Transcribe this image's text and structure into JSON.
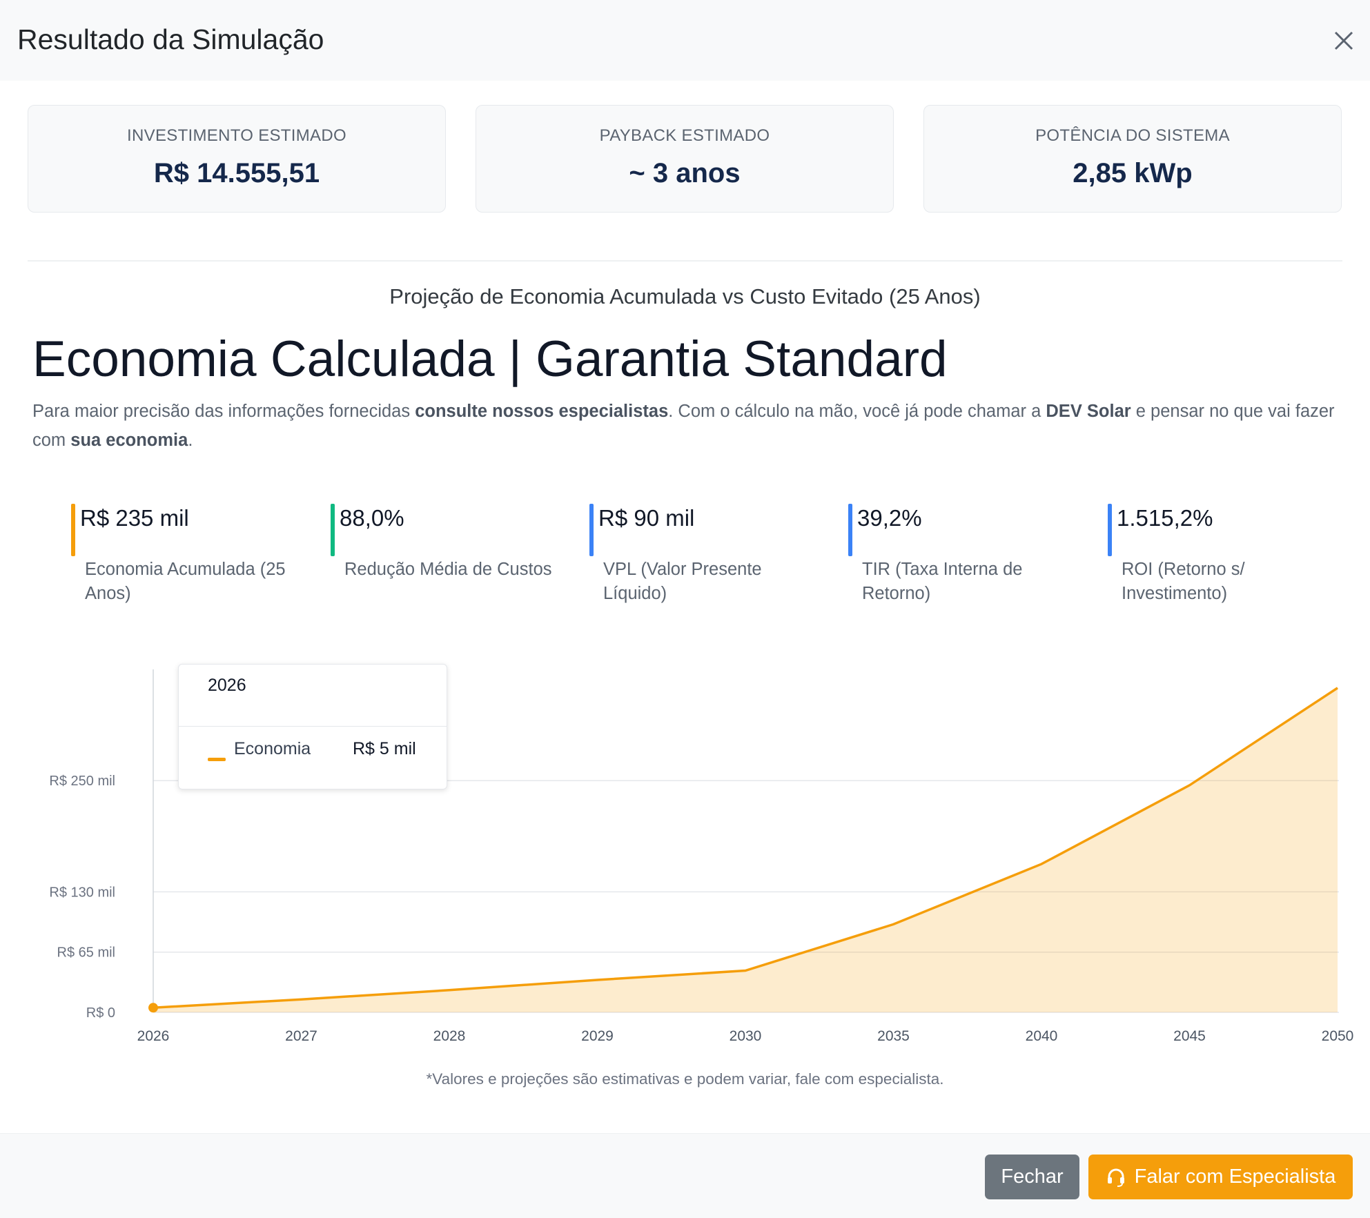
{
  "header": {
    "title": "Resultado da Simulação"
  },
  "cards": [
    {
      "label": "INVESTIMENTO ESTIMADO",
      "value": "R$ 14.555,51"
    },
    {
      "label": "PAYBACK ESTIMADO",
      "value": "~ 3 anos"
    },
    {
      "label": "POTÊNCIA DO SISTEMA",
      "value": "2,85 kWp"
    }
  ],
  "section_title": "Projeção de Economia Acumulada vs Custo Evitado (25 Anos)",
  "headline": "Economia Calculada | Garantia Standard",
  "description": {
    "p1": "Para maior precisão das informações fornecidas ",
    "b1": "consulte nossos especialistas",
    "p2": ". Com o cálculo na mão, você já pode chamar a ",
    "b2": "DEV Solar",
    "p3": " e pensar no que vai fazer com ",
    "b3": "sua economia",
    "p4": "."
  },
  "metrics": [
    {
      "value": "R$ 235 mil",
      "label": "Economia Acumulada (25 Anos)",
      "color": "#f59e0b"
    },
    {
      "value": "88,0%",
      "label": "Redução Média de Custos",
      "color": "#10b981"
    },
    {
      "value": "R$ 90 mil",
      "label": "VPL (Valor Presente Líquido)",
      "color": "#3b82f6"
    },
    {
      "value": "39,2%",
      "label": "TIR (Taxa Interna de Retorno)",
      "color": "#3b82f6"
    },
    {
      "value": "1.515,2%",
      "label": "ROI (Retorno s/ Investimento)",
      "color": "#3b82f6"
    }
  ],
  "chart_data": {
    "type": "area",
    "categories": [
      "2026",
      "2027",
      "2028",
      "2029",
      "2030",
      "2035",
      "2040",
      "2045",
      "2050"
    ],
    "series": [
      {
        "name": "Economia",
        "values": [
          5,
          14,
          24,
          35,
          45,
          95,
          160,
          245,
          350
        ],
        "color": "#f59e0b"
      }
    ],
    "y_tick_labels": [
      "R$ 0",
      "R$ 65 mil",
      "R$ 130 mil",
      "R$ 250 mil"
    ],
    "y_tick_values": [
      0,
      65,
      130,
      250
    ],
    "ylim": [
      0,
      370
    ],
    "grid": true,
    "tooltip": {
      "category": "2026",
      "series": "Economia",
      "value": "R$ 5 mil"
    }
  },
  "footnote": "*Valores e projeções são estimativas e podem variar, fale com especialista.",
  "buttons": {
    "close": "Fechar",
    "cta": "Falar com Especialista"
  },
  "icons": {
    "close": "close-icon",
    "cta": "headset-icon"
  }
}
